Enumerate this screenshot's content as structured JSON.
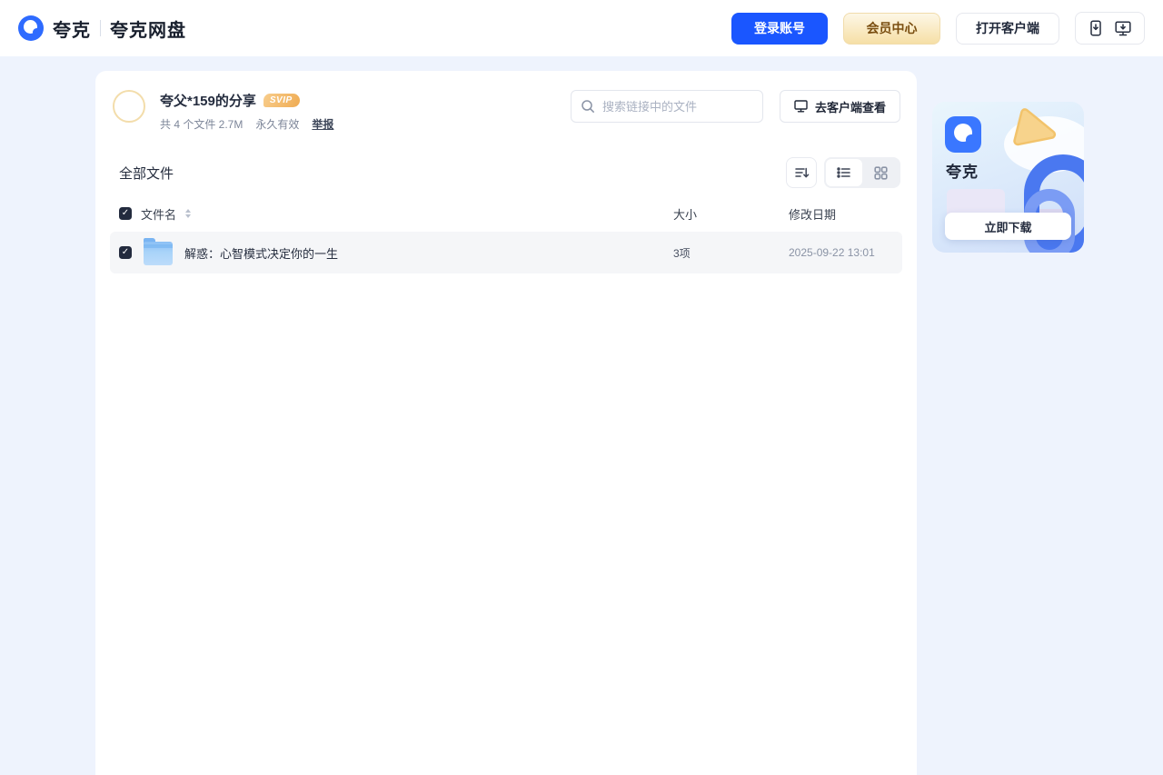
{
  "colors": {
    "accent_blue": "#1a56ff",
    "logo_blue": "#2e6bff",
    "vip_gold_text": "#7a4e10",
    "page_background": "#eef3fd",
    "selected_row_background": "#f5f6f8"
  },
  "header": {
    "brand": "夸克",
    "product": "夸克网盘",
    "login_button": "登录账号",
    "vip_button": "会员中心",
    "open_client_button": "打开客户端",
    "icons": {
      "mobile": "phone-download-icon",
      "desktop": "monitor-download-icon"
    }
  },
  "share": {
    "owner": "夸父*159的分享",
    "badge": "SVIP",
    "files_count": "共 4 个文件 2.7M",
    "validity": "永久有效",
    "report_link": "举报",
    "search_placeholder": "搜索链接中的文件",
    "view_in_client_button": "去客户端查看"
  },
  "files": {
    "section_title": "全部文件",
    "columns": {
      "name": "文件名",
      "size": "大小",
      "modified": "修改日期"
    },
    "rows": [
      {
        "name": "解惑：心智模式决定你的一生",
        "size": "3项",
        "modified": "2025-09-22 13:01",
        "type": "folder",
        "selected": true
      }
    ]
  },
  "promo": {
    "app_name": "夸克",
    "download_button": "立即下载"
  }
}
